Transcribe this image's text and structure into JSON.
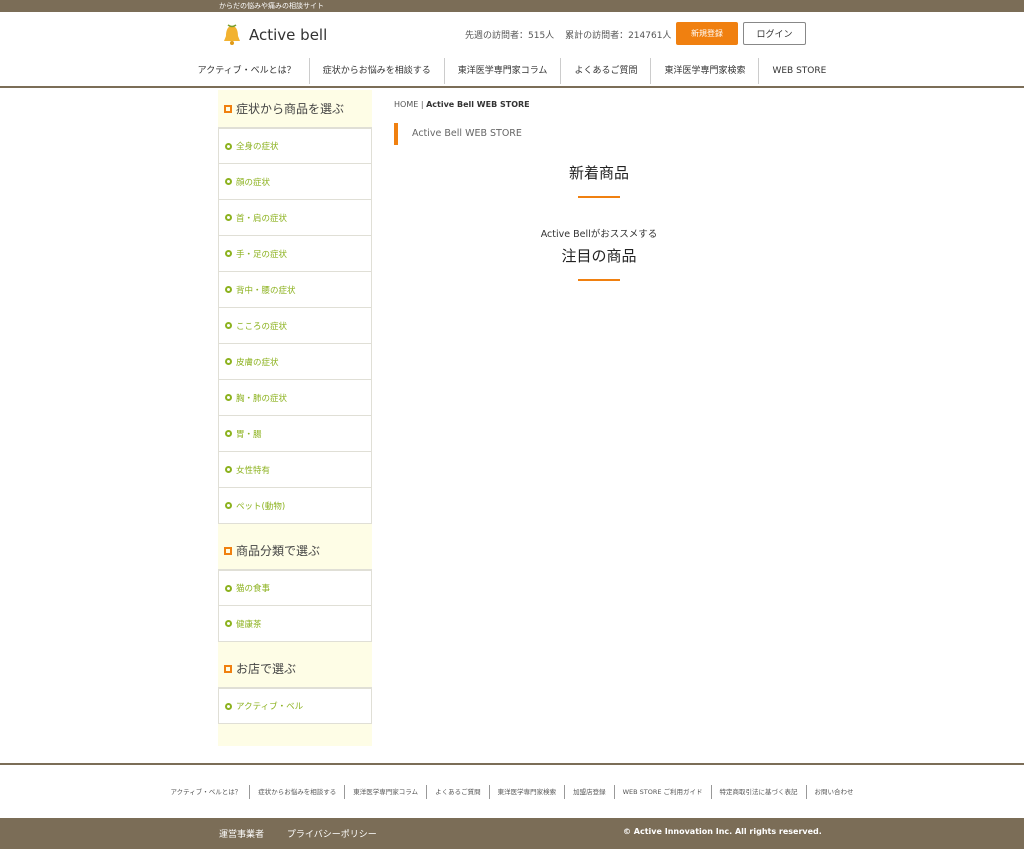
{
  "topbar": {
    "tagline": "からだの悩みや痛みの相談サイト"
  },
  "header": {
    "logo_text": "Active bell",
    "visitors_week": "先週の訪問者：515人",
    "visitors_total": "累計の訪問者：214761人",
    "register_label": "新規登録",
    "login_label": "ログイン"
  },
  "gnav": [
    "アクティブ・ベルとは？",
    "症状からお悩みを相談する",
    "東洋医学専門家コラム",
    "よくあるご質問",
    "東洋医学専門家検索",
    "WEB STORE"
  ],
  "sidebar": {
    "group1_title": "症状から商品を選ぶ",
    "group1_items": [
      "全身の症状",
      "顔の症状",
      "首・肩の症状",
      "手・足の症状",
      "背中・腰の症状",
      "こころの症状",
      "皮膚の症状",
      "胸・肺の症状",
      "胃・腸",
      "女性特有",
      "ペット(動物)"
    ],
    "group2_title": "商品分類で選ぶ",
    "group2_items": [
      "猫の食事",
      "健康茶"
    ],
    "group3_title": "お店で選ぶ",
    "group3_items": [
      "アクティブ・ベル"
    ]
  },
  "main": {
    "breadcrumb_home": "HOME",
    "breadcrumb_sep": "|",
    "breadcrumb_current": "Active Bell WEB STORE",
    "page_title": "Active Bell WEB STORE",
    "new_items_title": "新着商品",
    "recommend_caption": "Active Bellがおススメする",
    "featured_title": "注目の商品"
  },
  "footer_nav": [
    "アクティブ・ベルとは？",
    "症状からお悩みを相談する",
    "東洋医学専門家コラム",
    "よくあるご質問",
    "東洋医学専門家検索",
    "加盟店登録",
    "WEB STORE ご利用ガイド",
    "特定商取引法に基づく表記",
    "お問い合わせ"
  ],
  "footer_bottom": {
    "operator_label": "運営事業者",
    "privacy_label": "プライバシーポリシー",
    "copyright": "© Active Innovation Inc. All rights reserved."
  },
  "colors": {
    "accent": "#f08010",
    "brand_brown": "#7b6d57",
    "sidebar_bg": "#fefde6",
    "link_green": "#8cb21f"
  }
}
